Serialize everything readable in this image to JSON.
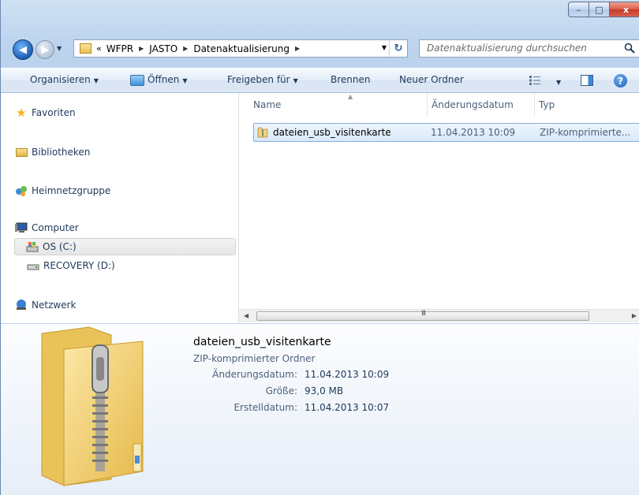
{
  "window": {
    "caption_buttons": {
      "minimize": "–",
      "maximize": "□",
      "close": "x"
    }
  },
  "navigation": {
    "back_icon": "back-arrow-icon",
    "forward_icon": "forward-arrow-icon"
  },
  "address_bar": {
    "overflow_chevron": "«",
    "crumbs": [
      "WFPR",
      "JASTO",
      "Datenaktualisierung"
    ],
    "separator": "▶"
  },
  "search": {
    "placeholder": "Datenaktualisierung durchsuchen"
  },
  "toolbar": {
    "organize": "Organisieren",
    "open": "Öffnen",
    "share": "Freigeben für",
    "burn": "Brennen",
    "new_folder": "Neuer Ordner",
    "help": "?"
  },
  "nav_pane": {
    "favorites": "Favoriten",
    "libraries": "Bibliotheken",
    "homegroup": "Heimnetzgruppe",
    "computer": "Computer",
    "drive_c": "OS (C:)",
    "drive_d": "RECOVERY (D:)",
    "network": "Netzwerk"
  },
  "columns": {
    "name": "Name",
    "modified": "Änderungsdatum",
    "type": "Typ"
  },
  "files": [
    {
      "name": "dateien_usb_visitenkarte",
      "modified": "11.04.2013 10:09",
      "type": "ZIP-komprimierte..."
    }
  ],
  "scrollbar": {
    "grip": "III"
  },
  "details": {
    "title": "dateien_usb_visitenkarte",
    "type": "ZIP-komprimierter Ordner",
    "modified_label": "Änderungsdatum:",
    "modified_value": "11.04.2013 10:09",
    "size_label": "Größe:",
    "size_value": "93,0 MB",
    "created_label": "Erstelldatum:",
    "created_value": "11.04.2013 10:07"
  },
  "colors": {
    "selection_fill": "#d9e9fb",
    "selection_border": "#84acdd",
    "chrome": "#bcd3ee",
    "text": "#1e395b"
  }
}
